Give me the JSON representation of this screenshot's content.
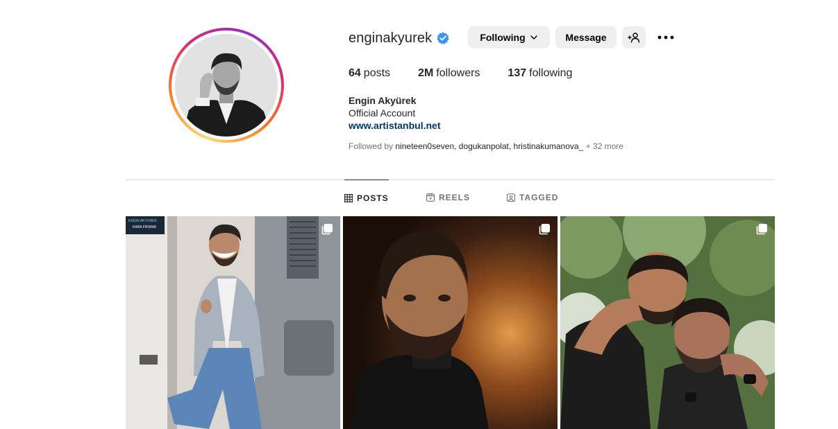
{
  "profile": {
    "username": "enginakyurek",
    "verified": true,
    "buttons": {
      "following_label": "Following",
      "message_label": "Message"
    },
    "stats": {
      "posts_count": "64",
      "posts_label": "posts",
      "followers_count": "2M",
      "followers_label": "followers",
      "following_count": "137",
      "following_label": "following"
    },
    "full_name": "Engin Akyürek",
    "category": "Official Account",
    "website": "www.artistanbul.net",
    "followed_by": {
      "prefix": "Followed by",
      "names": "nineteen0seven, dogukanpolat, hristinakumanova_",
      "more": "+ 32 more"
    }
  },
  "tabs": [
    {
      "label": "POSTS",
      "icon": "grid-icon",
      "active": true
    },
    {
      "label": "REELS",
      "icon": "reels-icon",
      "active": false
    },
    {
      "label": "TAGGED",
      "icon": "tagged-icon",
      "active": false
    }
  ],
  "posts": [
    {
      "type": "carousel",
      "sign_text": [
        "ENGIN AKYÜREK",
        "KARA FIKRAM"
      ]
    },
    {
      "type": "carousel"
    },
    {
      "type": "carousel"
    }
  ],
  "colors": {
    "verified_blue": "#3897f0",
    "link_blue": "#00376b",
    "button_gray": "#efefef",
    "divider": "#dbdbdb"
  }
}
